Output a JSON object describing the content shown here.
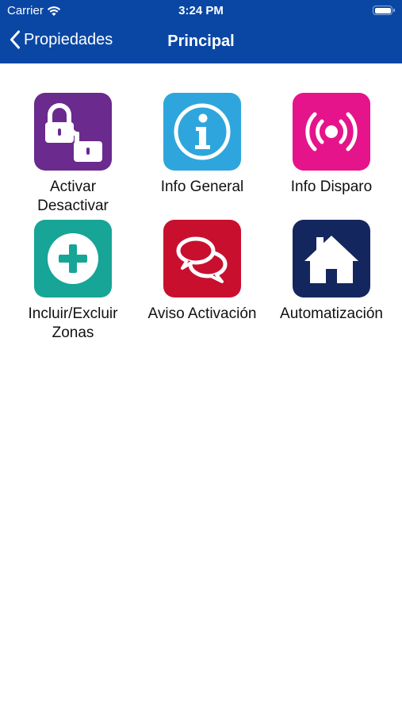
{
  "status_bar": {
    "carrier": "Carrier",
    "time": "3:24 PM",
    "icons": [
      "wifi-icon",
      "battery-icon"
    ]
  },
  "nav": {
    "back_label": "Propiedades",
    "title": "Principal",
    "bar_color": "#0a47a4"
  },
  "tiles": [
    {
      "label": "Activar\nDesactivar",
      "icon": "padlocks-icon",
      "color": "#6a2a8e"
    },
    {
      "label": "Info General",
      "icon": "info-icon",
      "color": "#2ea6dd"
    },
    {
      "label": "Info Disparo",
      "icon": "alarm-broadcast-icon",
      "color": "#e5148a"
    },
    {
      "label": "Incluir/Excluir\nZonas",
      "icon": "plus-circle-icon",
      "color": "#16a597"
    },
    {
      "label": "Aviso Activación",
      "icon": "chat-bubbles-icon",
      "color": "#c8102e"
    },
    {
      "label": "Automatización",
      "icon": "house-icon",
      "color": "#14265e"
    }
  ]
}
